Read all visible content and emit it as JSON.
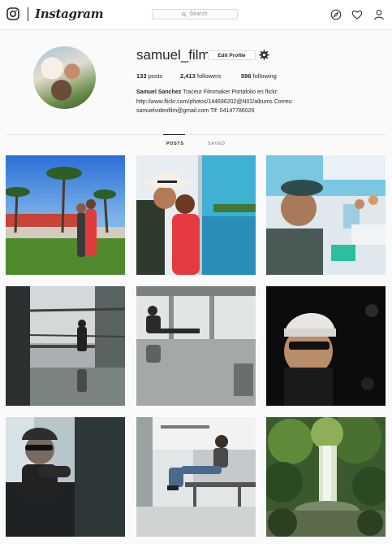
{
  "nav": {
    "brand": "Instagram",
    "search_placeholder": "Search",
    "icons": [
      "instagram-camera-icon",
      "compass-icon",
      "heart-icon",
      "user-icon"
    ]
  },
  "profile": {
    "username": "samuel_film",
    "edit_label": "Edit Profile",
    "posts_count": "133",
    "posts_label": "posts",
    "followers_count": "2,413",
    "followers_label": "followers",
    "following_count": "596",
    "following_label": "following",
    "full_name": "Samuel Sanchez",
    "bio_line1": "Traceur Filmmaker Portafolio en flickr:",
    "bio_line2": "http://www.flickr.com/photos/144696202@N02/albums Correo:",
    "bio_line3": "samuelvideofilm@gmail.com Tlf: 04147786026"
  },
  "tabs": {
    "posts": "POSTS",
    "saved": "SAVED",
    "active": "posts"
  },
  "colors": {
    "background": "#fafafa",
    "text": "#262626",
    "border": "#dbdbdb"
  },
  "posts": [
    "couple-palm-trees-photo",
    "couple-kiss-boat-photo",
    "man-cap-boat-selfie-photo",
    "silhouette-building-reflection-photo",
    "man-sitting-reflection-photo",
    "man-cap-sunglasses-dark-photo",
    "man-cap-sunglasses-bw-photo",
    "man-sitting-airport-chairs-photo",
    "jungle-waterfall-photo"
  ]
}
